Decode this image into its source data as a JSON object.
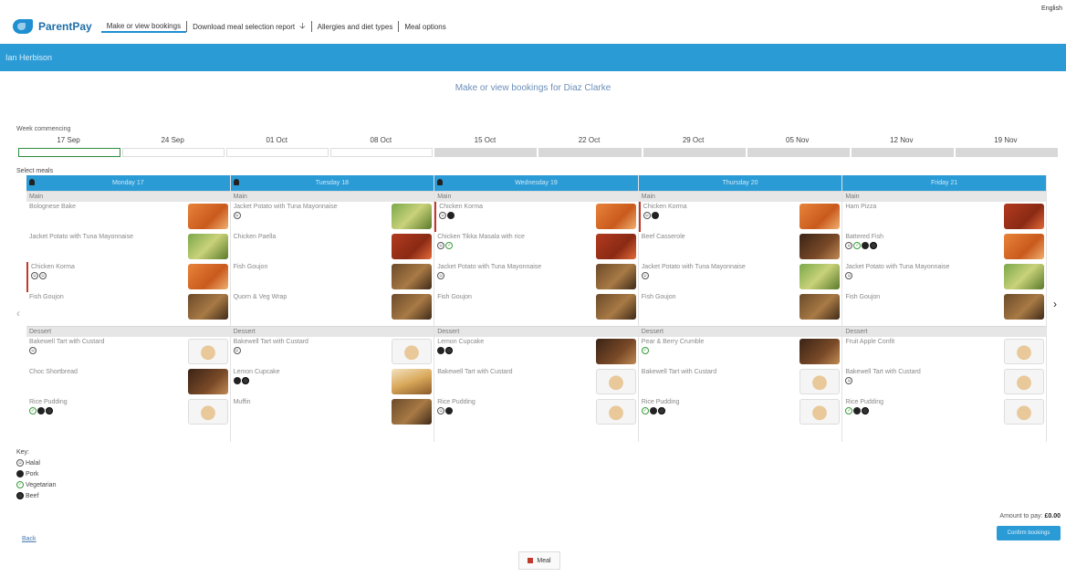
{
  "language": "English",
  "brand": "ParentPay",
  "nav": [
    {
      "label": "Make or view bookings",
      "active": true
    },
    {
      "label": "Download meal selection report"
    },
    {
      "label": "Allergies and diet types"
    },
    {
      "label": "Meal options"
    }
  ],
  "banner": "Ian Herbison",
  "subtitle": "Make or view bookings for Diaz Clarke",
  "week_label": "Week commencing",
  "weeks": [
    "17 Sep",
    "24 Sep",
    "01 Oct",
    "08 Oct",
    "15 Oct",
    "22 Oct",
    "29 Oct",
    "05 Nov",
    "12 Nov",
    "19 Nov"
  ],
  "select_meals_label": "Select meals",
  "sections": {
    "main": "Main",
    "dessert": "Dessert"
  },
  "days": [
    {
      "label": "Monday 17",
      "main": [
        {
          "name": "Bolognese Bake",
          "picked": false,
          "badges": [],
          "thumb": "orange"
        },
        {
          "name": "Jacket Potato with Tuna Mayonnaise",
          "picked": false,
          "badges": [],
          "thumb": "salad"
        },
        {
          "name": "Chicken Korma",
          "picked": true,
          "badges": [
            "halal",
            "halal"
          ],
          "thumb": "orange"
        },
        {
          "name": "Fish Goujon",
          "picked": false,
          "badges": [],
          "thumb": "brown"
        }
      ],
      "dessert": [
        {
          "name": "Bakewell Tart with Custard",
          "picked": false,
          "badges": [
            "halal"
          ],
          "thumb": "plate"
        },
        {
          "name": "Choc Shortbread",
          "picked": false,
          "badges": [],
          "thumb": "dark"
        },
        {
          "name": "Rice Pudding",
          "picked": false,
          "badges": [
            "veg",
            "pork",
            "beef"
          ],
          "thumb": "plate"
        }
      ]
    },
    {
      "label": "Tuesday 18",
      "main": [
        {
          "name": "Jacket Potato with Tuna Mayonnaise",
          "picked": false,
          "badges": [
            "halal"
          ],
          "thumb": "salad"
        },
        {
          "name": "Chicken Paella",
          "picked": false,
          "badges": [],
          "thumb": "red"
        },
        {
          "name": "Fish Goujon",
          "picked": false,
          "badges": [],
          "thumb": "brown"
        },
        {
          "name": "Quorn & Veg Wrap",
          "picked": false,
          "badges": [],
          "thumb": "brown"
        }
      ],
      "dessert": [
        {
          "name": "Bakewell Tart with Custard",
          "picked": false,
          "badges": [
            "halal"
          ],
          "thumb": "plate"
        },
        {
          "name": "Lemon Cupcake",
          "picked": false,
          "badges": [
            "pork",
            "beef"
          ],
          "thumb": "cake"
        },
        {
          "name": "Muffin",
          "picked": false,
          "badges": [],
          "thumb": "brown"
        }
      ]
    },
    {
      "label": "Wednesday 19",
      "main": [
        {
          "name": "Chicken Korma",
          "picked": true,
          "badges": [
            "halal",
            "pork"
          ],
          "thumb": "orange"
        },
        {
          "name": "Chicken Tikka Masala with rice",
          "picked": false,
          "badges": [
            "halal",
            "veg"
          ],
          "thumb": "red"
        },
        {
          "name": "Jacket Potato with Tuna Mayonnaise",
          "picked": false,
          "badges": [
            "halal"
          ],
          "thumb": "brown"
        },
        {
          "name": "Fish Goujon",
          "picked": false,
          "badges": [],
          "thumb": "brown"
        }
      ],
      "dessert": [
        {
          "name": "Lemon Cupcake",
          "picked": false,
          "badges": [
            "pork",
            "beef"
          ],
          "thumb": "dark"
        },
        {
          "name": "Bakewell Tart with Custard",
          "picked": false,
          "badges": [],
          "thumb": "plate"
        },
        {
          "name": "Rice Pudding",
          "picked": false,
          "badges": [
            "halal",
            "pork"
          ],
          "thumb": "plate"
        }
      ]
    },
    {
      "label": "Thursday 20",
      "main": [
        {
          "name": "Chicken Korma",
          "picked": true,
          "badges": [
            "halal",
            "pork"
          ],
          "thumb": "orange"
        },
        {
          "name": "Beef Casserole",
          "picked": false,
          "badges": [],
          "thumb": "dark"
        },
        {
          "name": "Jacket Potato with Tuna Mayonnaise",
          "picked": false,
          "badges": [
            "halal"
          ],
          "thumb": "salad"
        },
        {
          "name": "Fish Goujon",
          "picked": false,
          "badges": [],
          "thumb": "brown"
        }
      ],
      "dessert": [
        {
          "name": "Pear & Berry Crumble",
          "picked": false,
          "badges": [
            "veg"
          ],
          "thumb": "dark"
        },
        {
          "name": "Bakewell Tart with Custard",
          "picked": false,
          "badges": [],
          "thumb": "plate"
        },
        {
          "name": "Rice Pudding",
          "picked": false,
          "badges": [
            "veg",
            "pork",
            "beef"
          ],
          "thumb": "plate"
        }
      ]
    },
    {
      "label": "Friday 21",
      "main": [
        {
          "name": "Ham Pizza",
          "picked": false,
          "badges": [],
          "thumb": "red"
        },
        {
          "name": "Battered Fish",
          "picked": false,
          "badges": [
            "halal",
            "veg",
            "pork",
            "beef"
          ],
          "thumb": "orange"
        },
        {
          "name": "Jacket Potato with Tuna Mayonnaise",
          "picked": false,
          "badges": [
            "halal"
          ],
          "thumb": "salad"
        },
        {
          "name": "Fish Goujon",
          "picked": false,
          "badges": [],
          "thumb": "brown"
        }
      ],
      "dessert": [
        {
          "name": "Fruit Apple Confit",
          "picked": false,
          "badges": [],
          "thumb": "plate"
        },
        {
          "name": "Bakewell Tart with Custard",
          "picked": false,
          "badges": [
            "halal"
          ],
          "thumb": "plate"
        },
        {
          "name": "Rice Pudding",
          "picked": false,
          "badges": [
            "veg",
            "pork",
            "beef"
          ],
          "thumb": "plate"
        }
      ]
    }
  ],
  "key": {
    "title": "Key:",
    "items": [
      {
        "type": "halal",
        "label": "Halal"
      },
      {
        "type": "pork",
        "label": "Pork"
      },
      {
        "type": "veg",
        "label": "Vegetarian"
      },
      {
        "type": "beef",
        "label": "Beef"
      }
    ]
  },
  "amount_label": "Amount to pay:",
  "amount_value": "£0.00",
  "confirm_label": "Confirm bookings",
  "back_label": "Back",
  "legend_label": "Meal",
  "colors": {
    "accent": "#2b9bd6",
    "selected_border": "#c0392b"
  }
}
